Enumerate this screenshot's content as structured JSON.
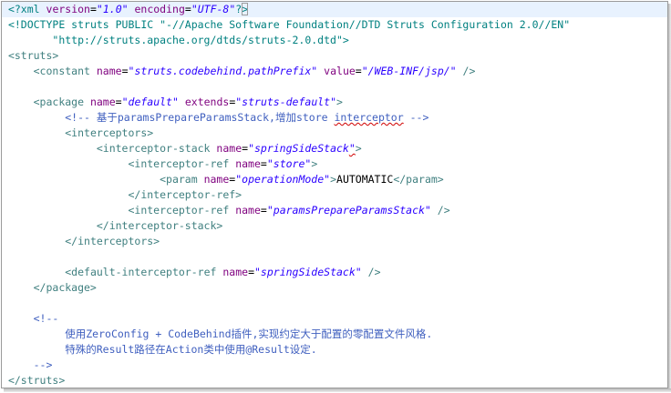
{
  "code": {
    "pi_open": "<?",
    "pi_name": "xml",
    "pi_attr_version": "version",
    "pi_val_version": "\"1.0\"",
    "pi_attr_encoding": "encoding",
    "pi_val_encoding": "\"UTF-8\"",
    "pi_close_1": "?",
    "pi_close_2": ">",
    "doctype_line_1": "<!DOCTYPE struts PUBLIC \"-//Apache Software Foundation//DTD Struts Configuration 2.0//EN\"",
    "doctype_line_2": "\"http://struts.apache.org/dtds/struts-2.0.dtd\">",
    "struts_open": "<struts>",
    "constant_open": "<constant",
    "constant_name_attr": "name",
    "constant_name_val": "\"struts.codebehind.pathPrefix\"",
    "constant_value_attr": "value",
    "constant_value_val": "\"/WEB-INF/jsp/\"",
    "constant_close": "/>",
    "package_open": "<package",
    "package_name_attr": "name",
    "package_name_val": "\"default\"",
    "package_extends_attr": "extends",
    "package_extends_val": "\"struts-default\"",
    "package_open_close": ">",
    "comment_1_prefix": "<!-- 基于paramsPrepareParamsStack,增加store ",
    "comment_1_wavy": "interceptor",
    "comment_1_suffix": " -->",
    "interceptors_open": "<interceptors>",
    "stack_open": "<interceptor-stack",
    "stack_name_attr": "name",
    "stack_name_val_1": "\"springSideStack",
    "stack_name_val_2": "\"",
    "stack_open_close": ">",
    "ref_store_open": "<interceptor-ref",
    "ref_store_name_attr": "name",
    "ref_store_name_val": "\"store\"",
    "ref_store_open_close": ">",
    "param_open": "<param",
    "param_name_attr": "name",
    "param_name_val": "\"operationMode\"",
    "param_open_close": ">",
    "param_text": "AUTOMATIC",
    "param_close": "</param>",
    "ref_store_close": "</interceptor-ref>",
    "ref_pp_open": "<interceptor-ref",
    "ref_pp_name_attr": "name",
    "ref_pp_name_val": "\"paramsPrepareParamsStack\"",
    "ref_pp_close": "/>",
    "stack_close": "</interceptor-stack>",
    "interceptors_close": "</interceptors>",
    "default_ref_open": "<default-interceptor-ref",
    "default_ref_name_attr": "name",
    "default_ref_name_val": "\"springSideStack\"",
    "default_ref_close": "/>",
    "package_close": "</package>",
    "comment_2_open": "<!--",
    "comment_2_line_1": "使用ZeroConfig + CodeBehind插件,实现约定大于配置的零配置文件风格.",
    "comment_2_line_2": "特殊的Result路径在Action类中使用@Result设定.",
    "comment_2_close": "-->",
    "struts_close": "</struts>",
    "equals": "="
  }
}
